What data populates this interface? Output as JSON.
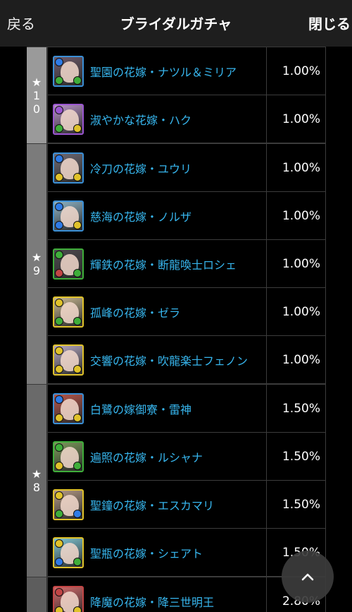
{
  "header": {
    "back_label": "戻る",
    "title": "ブライダルガチャ",
    "close_label": "閉じる"
  },
  "colors": {
    "name_link": "#37b6ee",
    "header_bg": "#1e1e1e",
    "background": "#000000"
  },
  "groups": [
    {
      "rarity_star": "★",
      "rarity_digits": [
        "1",
        "0"
      ],
      "items": [
        {
          "name": "聖園の花嫁・ナツル＆ミリア",
          "rate": "1.00%",
          "icon": {
            "frame": "#3a8fd6",
            "bg": "#6e5a6a",
            "orbs": [
              "#2e7be6",
              "#3fae3a",
              "#3fae3a"
            ]
          }
        },
        {
          "name": "淑やかな花嫁・ハク",
          "rate": "1.00%",
          "icon": {
            "frame": "#9a55d0",
            "bg": "#b994c8",
            "orbs": [
              "#9a55d0",
              "#3fae3a",
              "#e0c22a"
            ]
          }
        }
      ]
    },
    {
      "rarity_star": "★",
      "rarity_digits": [
        "9"
      ],
      "items": [
        {
          "name": "冷刀の花嫁・ユウリ",
          "rate": "1.00%",
          "icon": {
            "frame": "#3a8fd6",
            "bg": "#6f6a74",
            "orbs": [
              "#2e7be6",
              "#e0c22a",
              "#e0c22a"
            ]
          }
        },
        {
          "name": "慈海の花嫁・ノルザ",
          "rate": "1.00%",
          "icon": {
            "frame": "#3a8fd6",
            "bg": "#8fb4c6",
            "orbs": [
              "#2e7be6",
              "#2e7be6",
              "#e0c22a"
            ]
          }
        },
        {
          "name": "輝鉄の花嫁・断龍喚士ロシェ",
          "rate": "1.00%",
          "icon": {
            "frame": "#3fae3a",
            "bg": "#4d4a4f",
            "orbs": [
              "#3fae3a",
              "#c24545",
              "#3fae3a"
            ]
          }
        },
        {
          "name": "孤峰の花嫁・ゼラ",
          "rate": "1.00%",
          "icon": {
            "frame": "#e0c22a",
            "bg": "#c9b992",
            "orbs": [
              "#e0c22a",
              "#3fae3a",
              "#3fae3a"
            ]
          }
        },
        {
          "name": "交響の花嫁・吹龍楽士フェノン",
          "rate": "1.00%",
          "icon": {
            "frame": "#e0c22a",
            "bg": "#b6a9c2",
            "orbs": [
              "#e0c22a",
              "#e0c22a",
              "#e0c22a"
            ]
          }
        }
      ]
    },
    {
      "rarity_star": "★",
      "rarity_digits": [
        "8"
      ],
      "items": [
        {
          "name": "白鷺の嫁御寮・雷神",
          "rate": "1.50%",
          "icon": {
            "frame": "#3a8fd6",
            "bg": "#b8564a",
            "orbs": [
              "#2e7be6",
              "#e0c22a",
              "#e0c22a"
            ]
          }
        },
        {
          "name": "遍照の花嫁・ルシャナ",
          "rate": "1.50%",
          "icon": {
            "frame": "#3fae3a",
            "bg": "#7c9a5a",
            "orbs": [
              "#3fae3a",
              "#e0c22a",
              "#3fae3a"
            ]
          }
        },
        {
          "name": "聖鐘の花嫁・エスカマリ",
          "rate": "1.50%",
          "icon": {
            "frame": "#e0c22a",
            "bg": "#b59a86",
            "orbs": [
              "#e0c22a",
              "#3fae3a",
              "#2e7be6"
            ]
          }
        },
        {
          "name": "聖瓶の花嫁・シェアト",
          "rate": "1.50%",
          "icon": {
            "frame": "#e0c22a",
            "bg": "#7fc7d6",
            "orbs": [
              "#e0c22a",
              "#2e7be6",
              "#3fae3a"
            ]
          }
        }
      ]
    },
    {
      "rarity_star": "",
      "rarity_digits": [],
      "items": [
        {
          "name": "降魔の花嫁・降三世明王",
          "rate": "2.80%",
          "icon": {
            "frame": "#c24545",
            "bg": "#d36a6a",
            "orbs": [
              "#c24545",
              "#e0c22a",
              "#e0c22a"
            ]
          }
        }
      ]
    }
  ]
}
